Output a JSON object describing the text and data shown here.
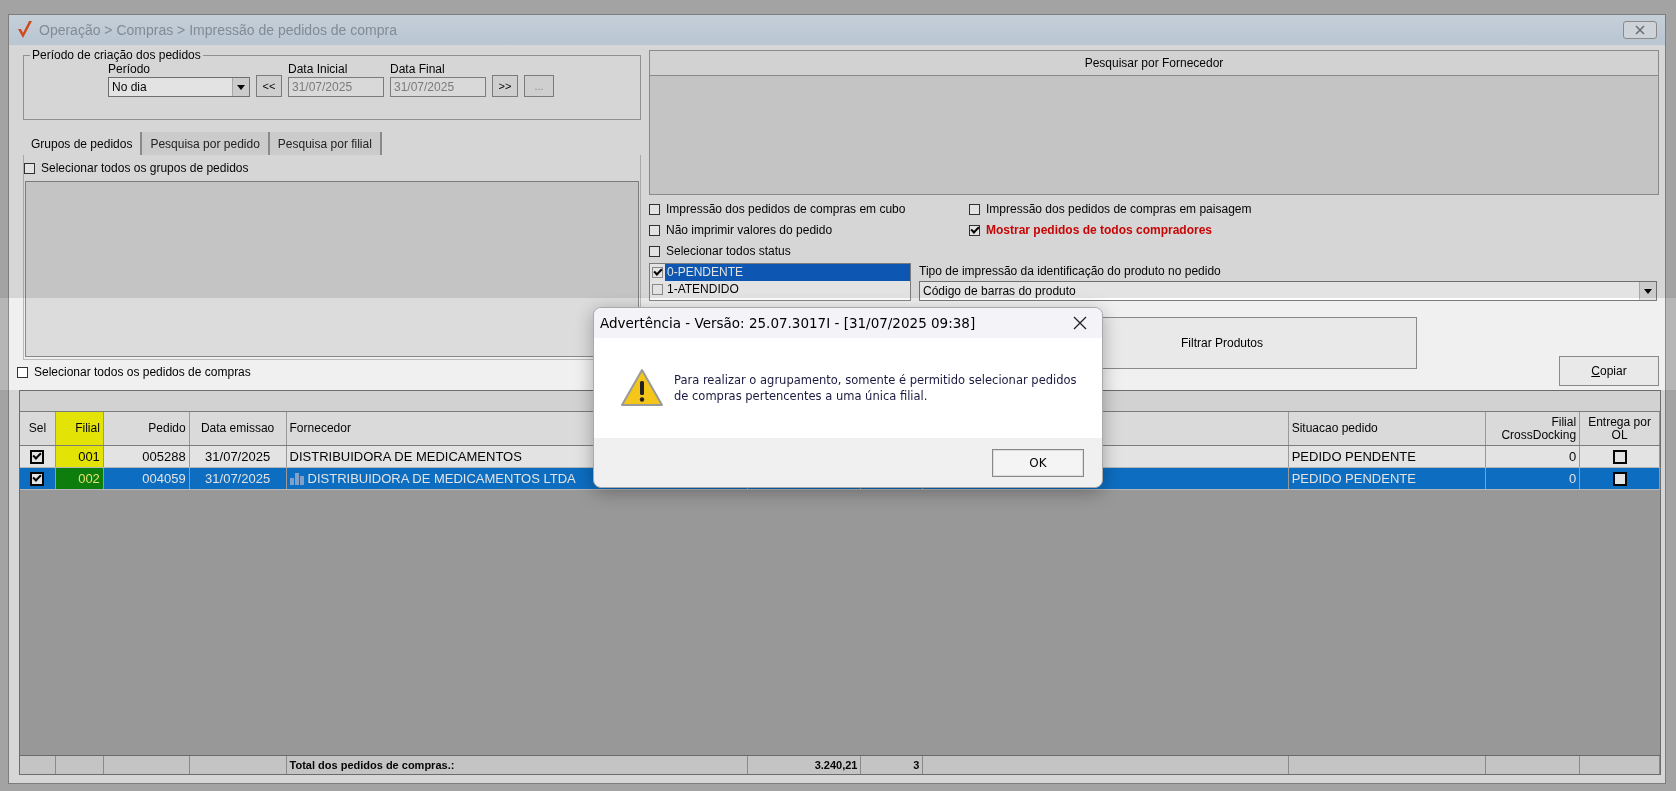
{
  "window": {
    "title": "Operação > Compras > Impressão de pedidos de compra"
  },
  "period_group": {
    "legend": "Período de criação dos pedidos",
    "period_label": "Período",
    "period_value": "No dia",
    "prev_button": "<<",
    "start_label": "Data Inicial",
    "start_date": "31/07/2025",
    "end_label": "Data Final",
    "end_date": "31/07/2025",
    "next_button": ">>",
    "more_button": "..."
  },
  "tabs": [
    {
      "label": "Grupos de pedidos",
      "selected": true
    },
    {
      "label": "Pesquisa por pedido",
      "selected": false
    },
    {
      "label": "Pesquisa por filial",
      "selected": false
    }
  ],
  "select_all_groups": {
    "label": "Selecionar todos os grupos de pedidos",
    "checked": false
  },
  "supplier_search": {
    "header": "Pesquisar por Fornecedor"
  },
  "options": [
    {
      "label": "Impressão dos pedidos de compras em cubo",
      "checked": false,
      "highlighted": false
    },
    {
      "label": "Impressão dos pedidos de compras em paisagem",
      "checked": false,
      "highlighted": false
    },
    {
      "label": "Não imprimir valores do pedido",
      "checked": false,
      "highlighted": false
    },
    {
      "label": "Mostrar pedidos de todos compradores",
      "checked": true,
      "highlighted": true
    }
  ],
  "select_all_status": {
    "label": "Selecionar todos status",
    "checked": false
  },
  "status_list": [
    {
      "label": "0-PENDENTE",
      "checked": true,
      "selected": true
    },
    {
      "label": "1-ATENDIDO",
      "checked": false,
      "selected": false
    }
  ],
  "print_type": {
    "label": "Tipo de impressão da identificação do produto no pedido",
    "value": "Código de barras do produto"
  },
  "filter_button": "Filtrar Produtos",
  "copy_button": "Copiar",
  "select_all_orders": {
    "label": "Selecionar todos os pedidos de compras",
    "checked": false
  },
  "table": {
    "columns": [
      {
        "label": "Sel",
        "highlighted": false
      },
      {
        "label": "Filial",
        "highlighted": true
      },
      {
        "label": "Pedido",
        "highlighted": false
      },
      {
        "label": "Data emissao",
        "highlighted": false
      },
      {
        "label": "Fornecedor",
        "highlighted": false
      },
      {},
      {},
      {
        "highlighted": false
      },
      {
        "label": "Situacao pedido",
        "highlighted": false
      },
      {
        "label": "Filial CrossDocking",
        "highlighted": false
      },
      {
        "label": "Entrega por OL",
        "highlighted": false
      }
    ],
    "rows": [
      {
        "selected": false,
        "checked": true,
        "filial": "001",
        "pedido": "005288",
        "data_emissao": "31/07/2025",
        "fornecedor": "DISTRIBUIDORA DE MEDICAMENTOS",
        "flagged": false,
        "situacao": "PEDIDO PENDENTE",
        "filial_crossdocking": "0",
        "entrega_ol": false
      },
      {
        "selected": true,
        "checked": true,
        "filial": "002",
        "pedido": "004059",
        "data_emissao": "31/07/2025",
        "fornecedor": "DISTRIBUIDORA DE MEDICAMENTOS LTDA",
        "flagged": true,
        "situacao": "PEDIDO PENDENTE",
        "filial_crossdocking": "0",
        "entrega_ol": false
      }
    ],
    "footer": {
      "label": "Total dos pedidos de compras.:",
      "total": "3.240,21",
      "count": "3"
    }
  },
  "dialog": {
    "title": "Advertência - Versão: 25.07.3017I - [31/07/2025 09:38]",
    "message": "Para realizar o agrupamento, somente é permitido selecionar pedidos de compras pertencentes a uma única filial.",
    "ok_button": "OK"
  }
}
